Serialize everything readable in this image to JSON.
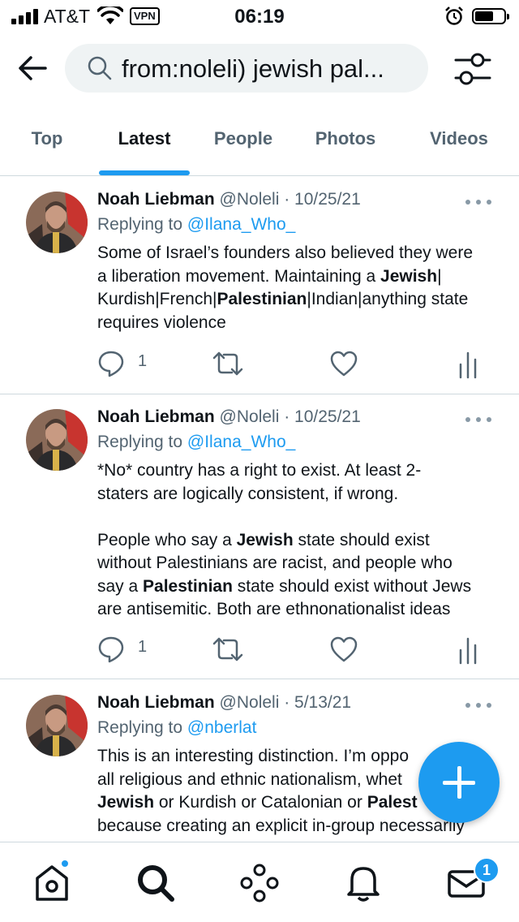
{
  "status_bar": {
    "carrier": "AT&T",
    "vpn_label": "VPN",
    "time": "06:19",
    "icons": [
      "signal-icon",
      "wifi-icon",
      "alarm-icon",
      "battery-icon"
    ]
  },
  "search": {
    "query": "from:noleli) jewish pal...",
    "icons": [
      "back-arrow-icon",
      "search-icon",
      "filter-icon"
    ]
  },
  "tabs": [
    {
      "label": "Top",
      "active": false
    },
    {
      "label": "Latest",
      "active": true
    },
    {
      "label": "People",
      "active": false
    },
    {
      "label": "Photos",
      "active": false
    },
    {
      "label": "Videos",
      "active": false
    }
  ],
  "tweets": [
    {
      "name": "Noah Liebman",
      "meta": "@Noleli · 10/25/21",
      "replying_prefix": "Replying to ",
      "replying_handle": "@Ilana_Who_",
      "lines": [
        [
          {
            "t": "Some of Israel’s founders also believed they were"
          }
        ],
        [
          {
            "t": "a liberation movement. Maintaining a "
          },
          {
            "t": "Jewish",
            "b": true
          },
          {
            "t": "|"
          }
        ],
        [
          {
            "t": "Kurdish|French|"
          },
          {
            "t": "Palestinian",
            "b": true
          },
          {
            "t": "|Indian|anything state"
          }
        ],
        [
          {
            "t": "requires violence"
          }
        ]
      ],
      "reply_count": "1"
    },
    {
      "name": "Noah Liebman",
      "meta": "@Noleli · 10/25/21",
      "replying_prefix": "Replying to ",
      "replying_handle": "@Ilana_Who_",
      "lines": [
        [
          {
            "t": "*No* country has a right to exist. At least 2-"
          }
        ],
        [
          {
            "t": "staters are logically consistent, if wrong."
          }
        ],
        [
          {
            "t": ""
          }
        ],
        [
          {
            "t": "People who say a "
          },
          {
            "t": "Jewish",
            "b": true
          },
          {
            "t": " state should exist"
          }
        ],
        [
          {
            "t": "without Palestinians are racist, and people who"
          }
        ],
        [
          {
            "t": "say a "
          },
          {
            "t": "Palestinian",
            "b": true
          },
          {
            "t": " state should exist without Jews"
          }
        ],
        [
          {
            "t": "are antisemitic. Both are ethnonationalist ideas"
          }
        ]
      ],
      "reply_count": "1"
    },
    {
      "name": "Noah Liebman",
      "meta": "@Noleli · 5/13/21",
      "replying_prefix": "Replying to ",
      "replying_handle": "@nberlat",
      "lines": [
        [
          {
            "t": "This is an interesting distinction. I’m oppo"
          }
        ],
        [
          {
            "t": "all religious and ethnic nationalism, whet"
          }
        ],
        [
          {
            "t": "Jewish",
            "b": true
          },
          {
            "t": " or Kurdish or Catalonian or "
          },
          {
            "t": "Palest",
            "b": true
          }
        ],
        [
          {
            "t": "because creating an explicit in-group necessarily"
          }
        ]
      ],
      "reply_count": ""
    }
  ],
  "bottom_nav": {
    "items": [
      "home-icon",
      "search-icon",
      "spaces-icon",
      "notifications-icon",
      "messages-icon"
    ],
    "messages_badge": "1"
  },
  "colors": {
    "accent": "#1d9bf0",
    "text": "#0f1419",
    "secondary": "#536471",
    "divider": "#cfd9de"
  }
}
